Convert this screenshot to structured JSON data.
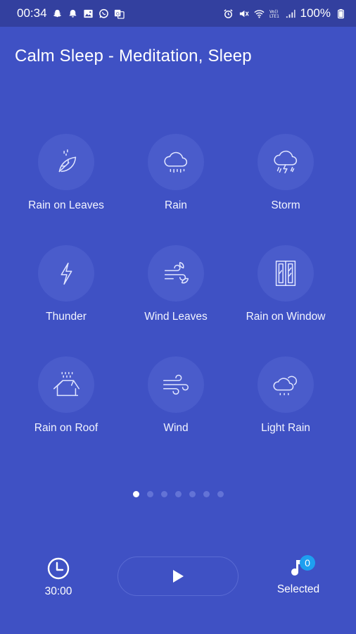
{
  "status_bar": {
    "time": "00:34",
    "battery": "100%",
    "left_icons": [
      "snapchat-icon",
      "notification-bell-icon",
      "gallery-icon",
      "whatsapp-icon",
      "translate-icon"
    ],
    "right_icons": [
      "alarm-icon",
      "mute-icon",
      "wifi-icon",
      "volte-icon",
      "signal-icon",
      "battery-icon"
    ]
  },
  "app": {
    "title": "Calm Sleep - Meditation, Sleep"
  },
  "sounds": [
    {
      "label": "Rain on Leaves",
      "icon": "leaf-rain-icon"
    },
    {
      "label": "Rain",
      "icon": "cloud-rain-icon"
    },
    {
      "label": "Storm",
      "icon": "storm-cloud-icon"
    },
    {
      "label": "Thunder",
      "icon": "lightning-icon"
    },
    {
      "label": "Wind Leaves",
      "icon": "wind-leaves-icon"
    },
    {
      "label": "Rain on Window",
      "icon": "window-icon"
    },
    {
      "label": "Rain on Roof",
      "icon": "roof-rain-icon"
    },
    {
      "label": "Wind",
      "icon": "wind-icon"
    },
    {
      "label": "Light Rain",
      "icon": "cloud-sun-rain-icon"
    }
  ],
  "pager": {
    "pages": 7,
    "active": 1
  },
  "bottom": {
    "timer": "30:00",
    "selected_label": "Selected",
    "selected_count": "0"
  },
  "colors": {
    "background": "#3f51c4",
    "statusbar": "#33409f",
    "badge": "#1e9ff0"
  }
}
